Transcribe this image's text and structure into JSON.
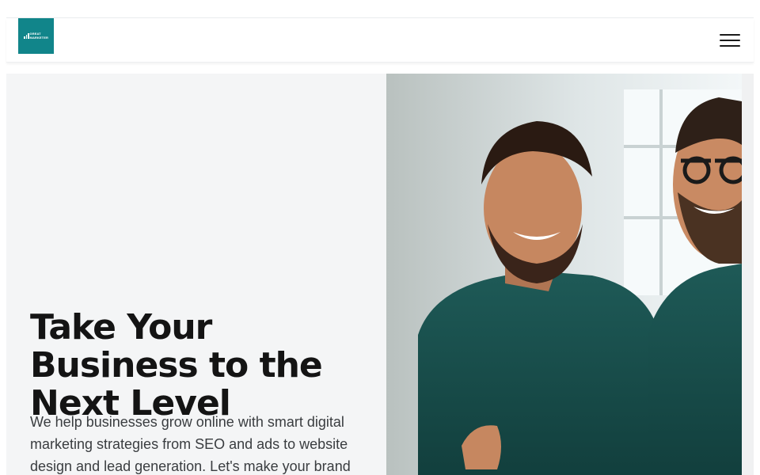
{
  "header": {
    "logo_text_line1": "GREAT",
    "logo_text_line2": "MARKETER",
    "menu_icon": "hamburger-menu-icon"
  },
  "hero": {
    "title": "Take Your Business to the Next Level",
    "description": "We help businesses grow online with smart digital marketing strategies from SEO and ads to website design and lead generation. Let's make your brand",
    "image": "two-smiling-men-in-teal-shirts"
  },
  "colors": {
    "brand": "#11858a",
    "hero_bg": "#f4f5f6",
    "title": "#141414",
    "text": "#3a3d40"
  }
}
